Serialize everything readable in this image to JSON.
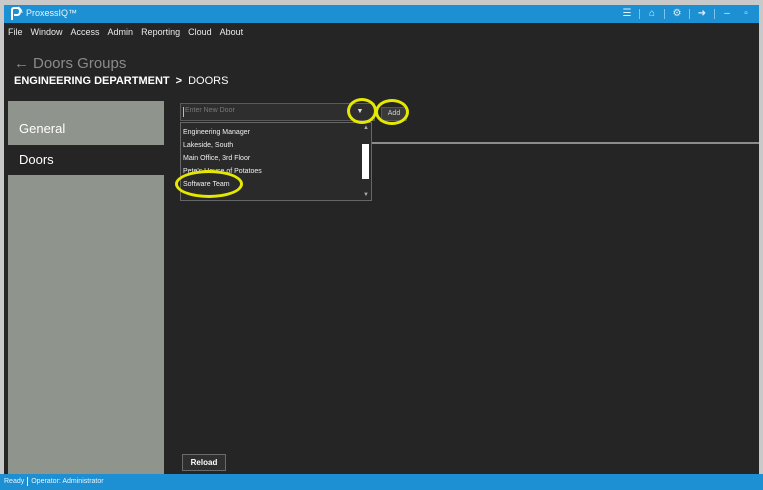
{
  "window": {
    "title": "ProxessIQ™",
    "accent": "#1d8fd3",
    "titlebar_icons": [
      "menu-icon",
      "home-icon",
      "gear-icon",
      "logout-icon",
      "minimize-icon",
      "maximize-icon"
    ]
  },
  "menu": {
    "items": [
      "File",
      "Window",
      "Access",
      "Admin",
      "Reporting",
      "Cloud",
      "About"
    ]
  },
  "header": {
    "back_label": "Doors Groups",
    "breadcrumb_group": "ENGINEERING DEPARTMENT",
    "breadcrumb_separator": ">",
    "breadcrumb_page": "DOORS"
  },
  "nav": {
    "items": [
      {
        "label": "General"
      },
      {
        "label": "Doors",
        "selected": true
      }
    ]
  },
  "door_entry": {
    "placeholder": "Enter New Door",
    "add_label": "Add",
    "dropdown_options": [
      "Engineering Manager",
      "Lakeside, South",
      "Main Office, 3rd Floor",
      "Pete's House of Potatoes",
      "Software Team"
    ]
  },
  "footer": {
    "reload_label": "Reload"
  },
  "status": {
    "state": "Ready",
    "operator": "Operator: Administrator"
  },
  "highlight_color": "#e5e800"
}
